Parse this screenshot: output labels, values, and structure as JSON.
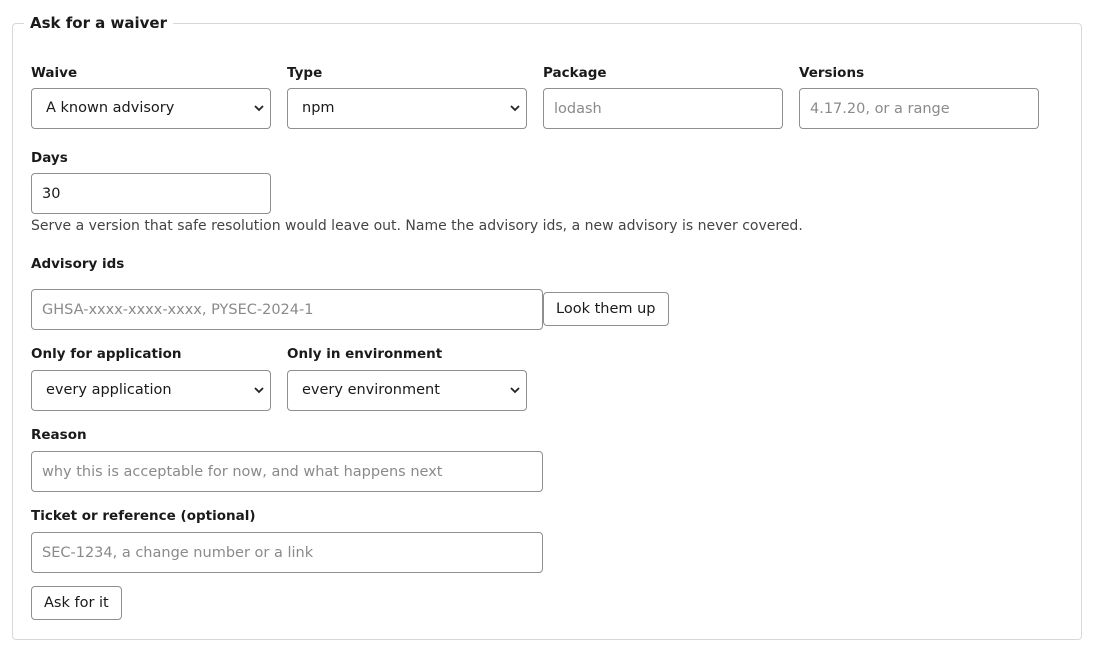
{
  "form": {
    "title": "Ask for a waiver",
    "waive": {
      "label": "Waive",
      "value": "A known advisory"
    },
    "type": {
      "label": "Type",
      "value": "npm"
    },
    "package": {
      "label": "Package",
      "placeholder": "lodash"
    },
    "versions": {
      "label": "Versions",
      "placeholder": "4.17.20, or a range"
    },
    "days": {
      "label": "Days",
      "value": "30"
    },
    "hint": "Serve a version that safe resolution would leave out. Name the advisory ids, a new advisory is never covered.",
    "advisory_ids": {
      "label": "Advisory ids",
      "placeholder": "GHSA-xxxx-xxxx-xxxx, PYSEC-2024-1",
      "lookup_label": "Look them up"
    },
    "application": {
      "label": "Only for application",
      "value": "every application"
    },
    "environment": {
      "label": "Only in environment",
      "value": "every environment"
    },
    "reason": {
      "label": "Reason",
      "placeholder": "why this is acceptable for now, and what happens next"
    },
    "ticket": {
      "label": "Ticket or reference (optional)",
      "placeholder": "SEC-1234, a change number or a link"
    },
    "submit_label": "Ask for it"
  },
  "icons": {
    "select_chevron": "chevron-down-icon"
  }
}
